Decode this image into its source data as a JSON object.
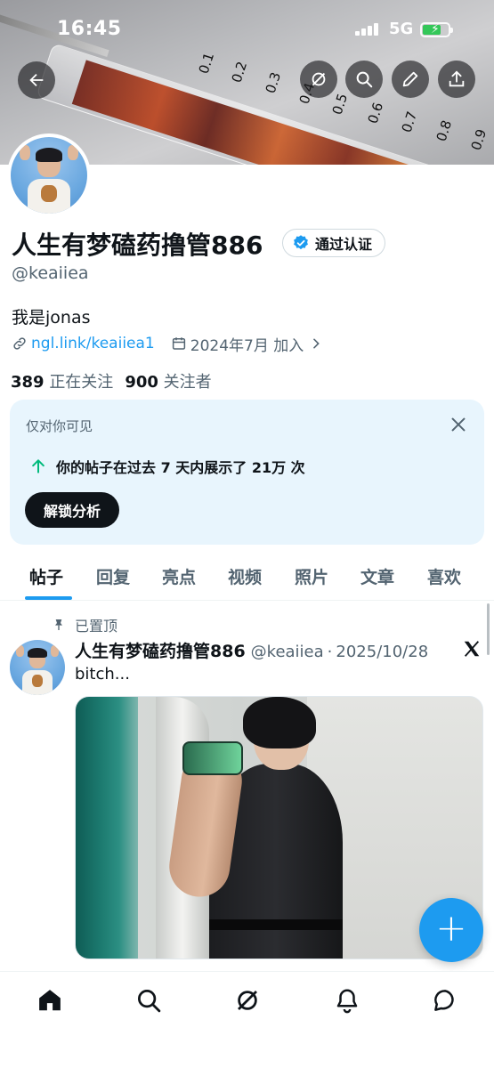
{
  "status_bar": {
    "time": "16:45",
    "network": "5G",
    "battery_charging": true
  },
  "banner": {
    "syringe_marks": [
      "0.1",
      "0.2",
      "0.3",
      "0.4",
      "0.5",
      "0.6",
      "0.7",
      "0.8",
      "0.9"
    ]
  },
  "header_buttons": {
    "back_icon": "arrow-left-icon",
    "grok_icon": "grok-icon",
    "search_icon": "search-icon",
    "edit_icon": "pencil-icon",
    "share_icon": "share-icon"
  },
  "profile": {
    "display_name": "人生有梦磕药撸管886",
    "verified_label": "通过认证",
    "handle": "@keaiiea",
    "bio": "我是jonas",
    "link": "ngl.link/keaiiea1",
    "joined": "2024年7月 加入",
    "following_count": "389",
    "following_label": "正在关注",
    "followers_count": "900",
    "followers_label": "关注者"
  },
  "insight_card": {
    "visibility_label": "仅对你可见",
    "stat_text": "你的帖子在过去 7 天内展示了 21万 次",
    "unlock_button": "解锁分析"
  },
  "tabs": [
    {
      "label": "帖子",
      "active": true
    },
    {
      "label": "回复",
      "active": false
    },
    {
      "label": "亮点",
      "active": false
    },
    {
      "label": "视频",
      "active": false
    },
    {
      "label": "照片",
      "active": false
    },
    {
      "label": "文章",
      "active": false
    },
    {
      "label": "喜欢",
      "active": false
    }
  ],
  "post": {
    "pinned_label": "已置顶",
    "author_name": "人生有梦磕药撸管886",
    "author_handle": "@keaiiea",
    "separator": "·",
    "date": "2025/10/28",
    "text": "bitch..."
  },
  "fab": {
    "label": "+"
  },
  "bottom_nav": [
    "home-icon",
    "search-icon",
    "grok-icon",
    "notifications-icon",
    "messages-icon"
  ],
  "colors": {
    "accent": "#1d9bf0",
    "text": "#0f1419",
    "muted": "#536471",
    "insight_bg": "#e8f5fd"
  }
}
